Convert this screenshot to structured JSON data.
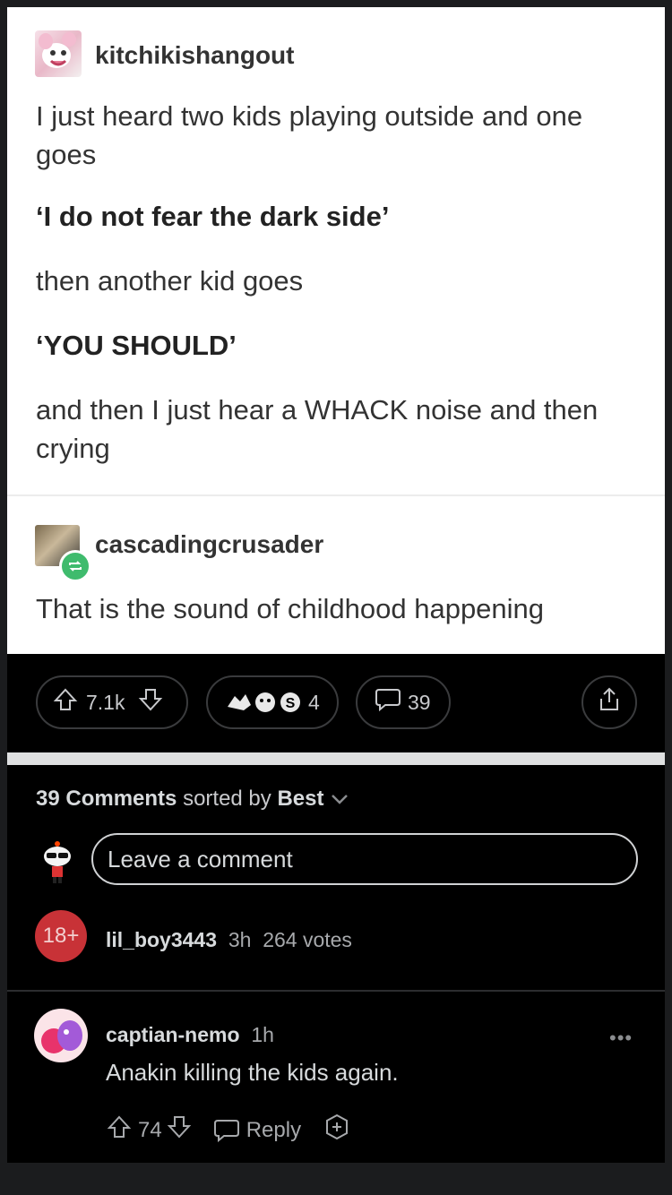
{
  "post": {
    "op_username": "kitchikishangout",
    "lines": [
      "I just heard two kids playing outside and one goes",
      "‘I do not fear the dark side’",
      "then another kid goes",
      "‘YOU SHOULD’",
      "and then I just hear a WHACK noise and then crying"
    ],
    "reblogger_username": "cascadingcrusader",
    "reblog_text": "That is the sound of childhood happening"
  },
  "actions": {
    "votes": "7.1k",
    "awards_count": "4",
    "comments_count": "39"
  },
  "comments_header": {
    "count_label": "39 Comments",
    "sorted_by": "sorted by",
    "sort": "Best"
  },
  "comment_input": {
    "placeholder": "Leave a comment"
  },
  "collapsed_comment": {
    "badge": "18+",
    "username": "lil_boy3443",
    "age": "3h",
    "votes": "264 votes"
  },
  "comment": {
    "username": "captian-nemo",
    "age": "1h",
    "text": "Anakin killing the kids again.",
    "votes": "74",
    "reply_label": "Reply",
    "more": "•••"
  },
  "colors": {
    "background": "#000000",
    "panel": "#ffffff",
    "reblog_green": "#3fbb6d",
    "nsfw_red": "#c83237"
  }
}
